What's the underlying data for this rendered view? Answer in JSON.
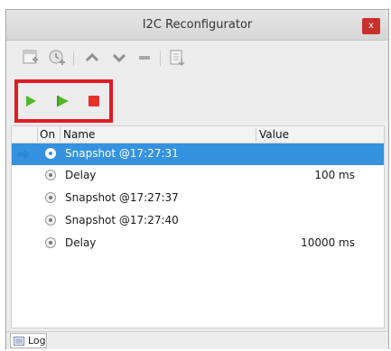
{
  "window": {
    "title": "I2C Reconfigurator",
    "close_glyph": "x"
  },
  "toolbar": {
    "icons": [
      "add-item-icon",
      "add-delay-icon",
      "move-up-icon",
      "move-down-icon",
      "remove-icon",
      "export-icon"
    ]
  },
  "playback": {
    "icons": [
      "play-icon",
      "play-step-icon",
      "stop-icon"
    ],
    "highlight_color": "#e01b22"
  },
  "table": {
    "columns": [
      "On",
      "Name",
      "Value"
    ],
    "rows": [
      {
        "name": "Snapshot @17:27:31",
        "value": "",
        "selected": true,
        "current": true
      },
      {
        "name": "Delay",
        "value": "100 ms",
        "selected": false,
        "current": false
      },
      {
        "name": "Snapshot @17:27:37",
        "value": "",
        "selected": false,
        "current": false
      },
      {
        "name": "Snapshot @17:27:40",
        "value": "",
        "selected": false,
        "current": false
      },
      {
        "name": "Delay",
        "value": "10000 ms",
        "selected": false,
        "current": false
      }
    ]
  },
  "bottom_tabs": [
    {
      "label": "Log",
      "icon": "log-icon"
    }
  ],
  "colors": {
    "selection": "#3592e0",
    "arrow": "#2a86d8",
    "play": "#4fb82a",
    "stop": "#e4322b",
    "close": "#c9302c"
  }
}
